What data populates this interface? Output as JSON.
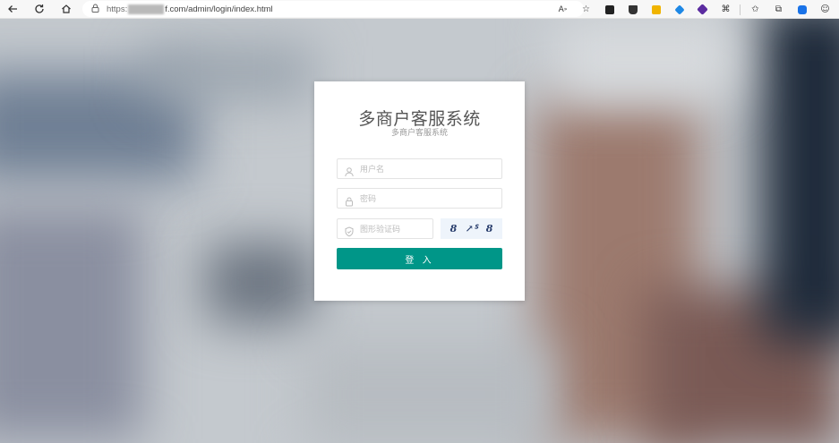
{
  "browser": {
    "url_prefix": "https:",
    "url_suffix": "f.com/admin/login/index.html"
  },
  "login": {
    "title": "多商户客服系统",
    "subtitle": "多商户客服系统",
    "username_placeholder": "用户名",
    "password_placeholder": "密码",
    "captcha_placeholder": "图形验证码",
    "captcha_chars": [
      "8",
      "↗ᔆ",
      "8"
    ],
    "submit_label": "登 入",
    "accent_color": "#009688"
  }
}
